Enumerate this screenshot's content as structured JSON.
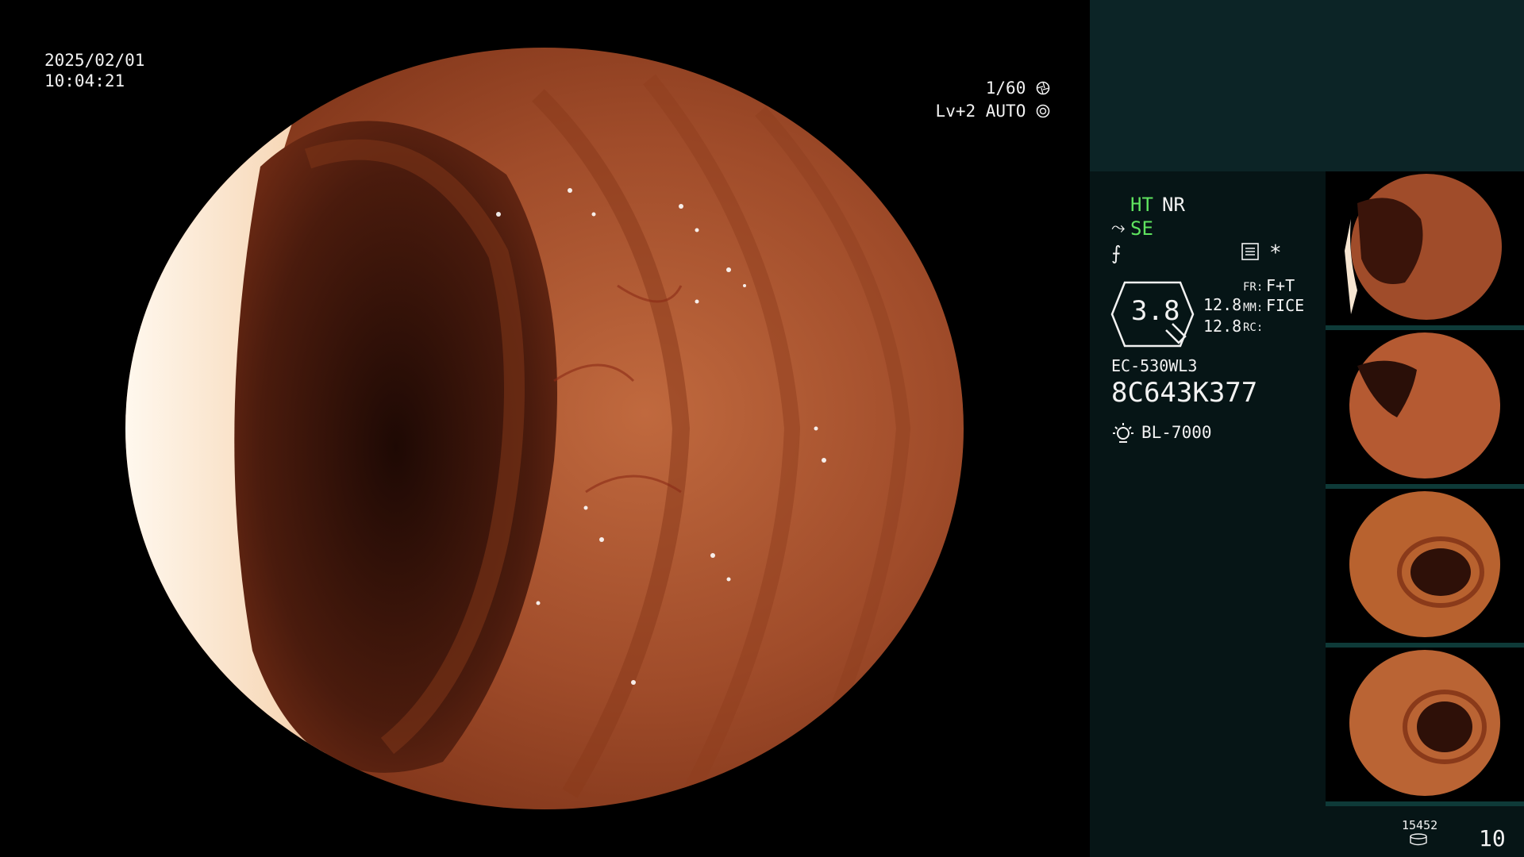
{
  "osd": {
    "date": "2025/02/01",
    "time": "10:04:21",
    "shutter": "1/60",
    "level": "Lv+2 AUTO"
  },
  "panel": {
    "mode_ht": "HT",
    "mode_nr": "NR",
    "mode_se": "SE",
    "zoom": "3.8",
    "zoom_values": [
      "12.8",
      "12.8"
    ],
    "fr_label": "FR:",
    "fr_value": "F+T",
    "mm_label": "MM:",
    "mm_value": "FICE",
    "rc_label": "RC:",
    "asterisk": "*",
    "scope_model": "EC-530WL3",
    "scope_serial": "8C643K377",
    "light_source": "BL-7000",
    "storage_count": "15452",
    "capture_count": "10"
  },
  "colors": {
    "panel_bg": "#061516",
    "panel_top_bg": "#0c2426",
    "mode_active": "#5fe35f",
    "mucosa": "#a8532f",
    "lumen": "#2a0f08"
  },
  "icons": {
    "shutter": "shutter-icon",
    "iris": "iris-icon",
    "se": "se-icon",
    "flag": "flag-icon",
    "menu": "menu-icon",
    "zoom": "zoom-icon",
    "light": "light-icon",
    "storage": "storage-icon"
  }
}
